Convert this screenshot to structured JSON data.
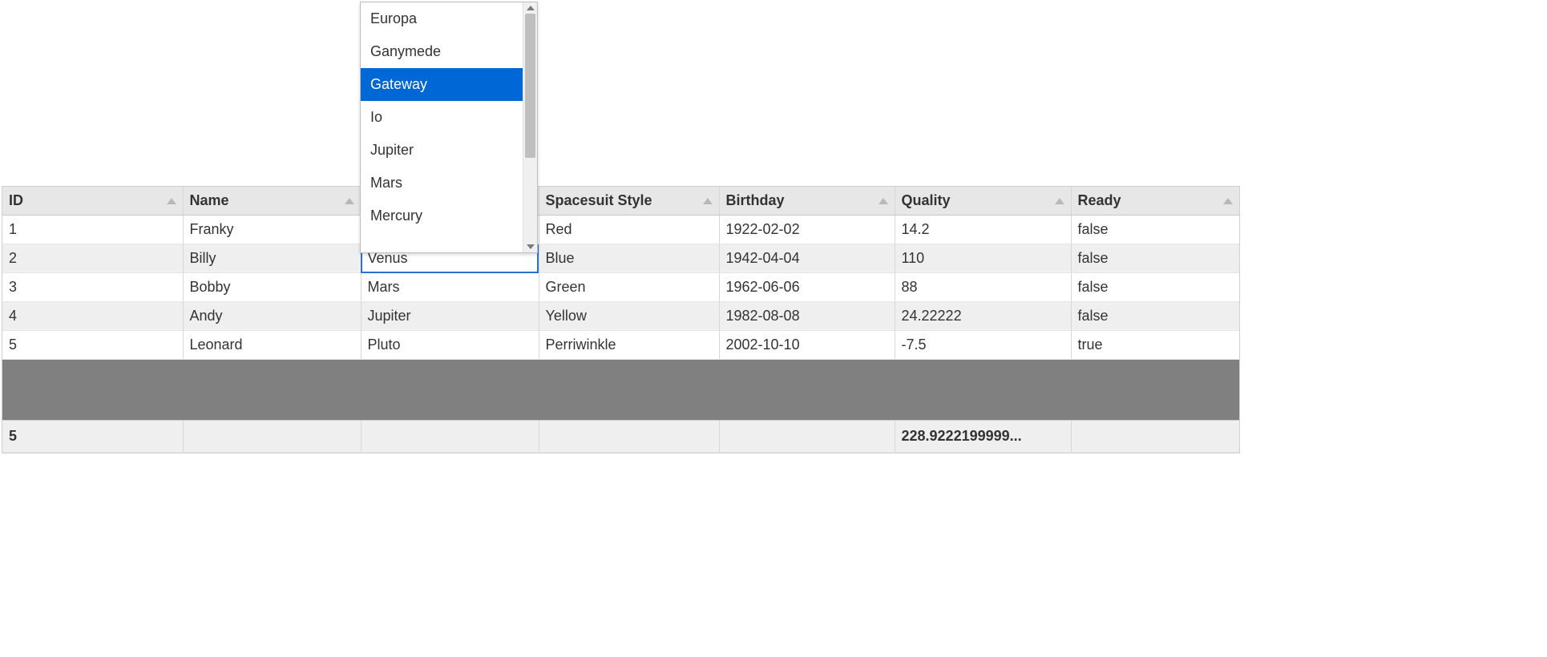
{
  "columns": {
    "id": "ID",
    "name": "Name",
    "dest": "",
    "suit": "Spacesuit Style",
    "birthday": "Birthday",
    "quality": "Quality",
    "ready": "Ready"
  },
  "rows": [
    {
      "id": "1",
      "name": "Franky",
      "dest": "",
      "suit": "Red",
      "birthday": "1922-02-02",
      "quality": "14.2",
      "ready": "false"
    },
    {
      "id": "2",
      "name": "Billy",
      "dest": "Venus",
      "suit": "Blue",
      "birthday": "1942-04-04",
      "quality": "110",
      "ready": "false"
    },
    {
      "id": "3",
      "name": "Bobby",
      "dest": "Mars",
      "suit": "Green",
      "birthday": "1962-06-06",
      "quality": "88",
      "ready": "false"
    },
    {
      "id": "4",
      "name": "Andy",
      "dest": "Jupiter",
      "suit": "Yellow",
      "birthday": "1982-08-08",
      "quality": "24.22222",
      "ready": "false"
    },
    {
      "id": "5",
      "name": "Leonard",
      "dest": "Pluto",
      "suit": "Perriwinkle",
      "birthday": "2002-10-10",
      "quality": "-7.5",
      "ready": "true"
    }
  ],
  "footer": {
    "id": "5",
    "name": "",
    "dest": "",
    "suit": "",
    "birthday": "",
    "quality": "228.9222199999...",
    "ready": ""
  },
  "dropdown": {
    "options": [
      "Europa",
      "Ganymede",
      "Gateway",
      "Io",
      "Jupiter",
      "Mars",
      "Mercury"
    ],
    "selected_index": 2
  },
  "editing_cell": {
    "row": 1,
    "col": "dest"
  }
}
